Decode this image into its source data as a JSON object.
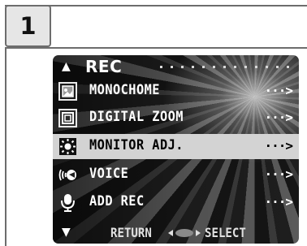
{
  "step": {
    "number": "1"
  },
  "menu": {
    "title": "REC",
    "items": [
      {
        "label": "MONOCHOME",
        "arrow": "···>",
        "icon": "monochrome-icon",
        "selected": false
      },
      {
        "label": "DIGITAL ZOOM",
        "arrow": "···>",
        "icon": "digital-zoom-icon",
        "selected": false
      },
      {
        "label": "MONITOR ADJ.",
        "arrow": "···>",
        "icon": "monitor-adjust-icon",
        "selected": true
      },
      {
        "label": "VOICE",
        "arrow": "···>",
        "icon": "voice-icon",
        "selected": false
      },
      {
        "label": "ADD REC",
        "arrow": "···>",
        "icon": "add-rec-microphone-icon",
        "selected": false
      }
    ],
    "footer": {
      "return_label": "RETURN",
      "select_label": "SELECT"
    }
  },
  "colors": {
    "selection": "#d3d3d3",
    "text": "#ffffff",
    "frame": "#6d6d6d"
  }
}
